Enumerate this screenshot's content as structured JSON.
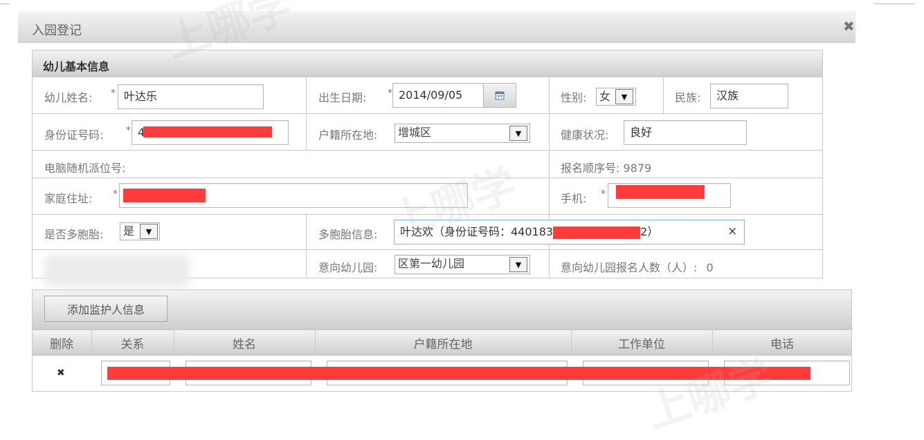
{
  "dialog": {
    "title": "入园登记",
    "close_icon": "close-icon",
    "close_glyph": "✖"
  },
  "child_info": {
    "section_title": "幼儿基本信息",
    "name_label": "幼儿姓名:",
    "name_value": "叶达乐",
    "birth_label": "出生日期:",
    "birth_value": "2014/09/05",
    "gender_label": "性别:",
    "gender_value": "女",
    "ethnicity_label": "民族:",
    "ethnicity_value": "汉族",
    "id_label": "身份证号码:",
    "id_value_visible": "4",
    "hukou_label": "户籍所在地:",
    "hukou_value": "增城区",
    "health_label": "健康状况:",
    "health_value": "良好",
    "computer_seat_label": "电脑随机派位号:",
    "reg_order_label": "报名顺序号:",
    "reg_order_value": "9879",
    "address_label": "家庭住址:",
    "phone_label": "手机:",
    "multiple_birth_label": "是否多胞胎:",
    "multiple_birth_value": "是",
    "multiple_info_label": "多胞胎信息:",
    "multiple_info_prefix": "叶达欢（身份证号码：440183",
    "multiple_info_suffix": "2）",
    "multiple_info_remove": "×",
    "kindergarten_label": "意向幼儿园:",
    "kindergarten_value": "区第一幼儿园",
    "kindergarten_count_label": "意向幼儿园报名人数（人）:",
    "kindergarten_count_value": "0",
    "required_mark": "*"
  },
  "guardian": {
    "add_button": "添加监护人信息",
    "columns": [
      "删除",
      "关系",
      "姓名",
      "户籍所在地",
      "工作单位",
      "电话"
    ],
    "row_delete_glyph": "✖"
  },
  "watermark": {
    "text": "上哪学"
  },
  "icons": {
    "calendar": "calendar-icon",
    "dropdown": "chevron-down-icon"
  },
  "colors": {
    "redaction": "#ff3c3c",
    "header_gradient_top": "#f3f3f3",
    "header_gradient_bottom": "#cfcfcf",
    "border": "#c9c9c9"
  }
}
